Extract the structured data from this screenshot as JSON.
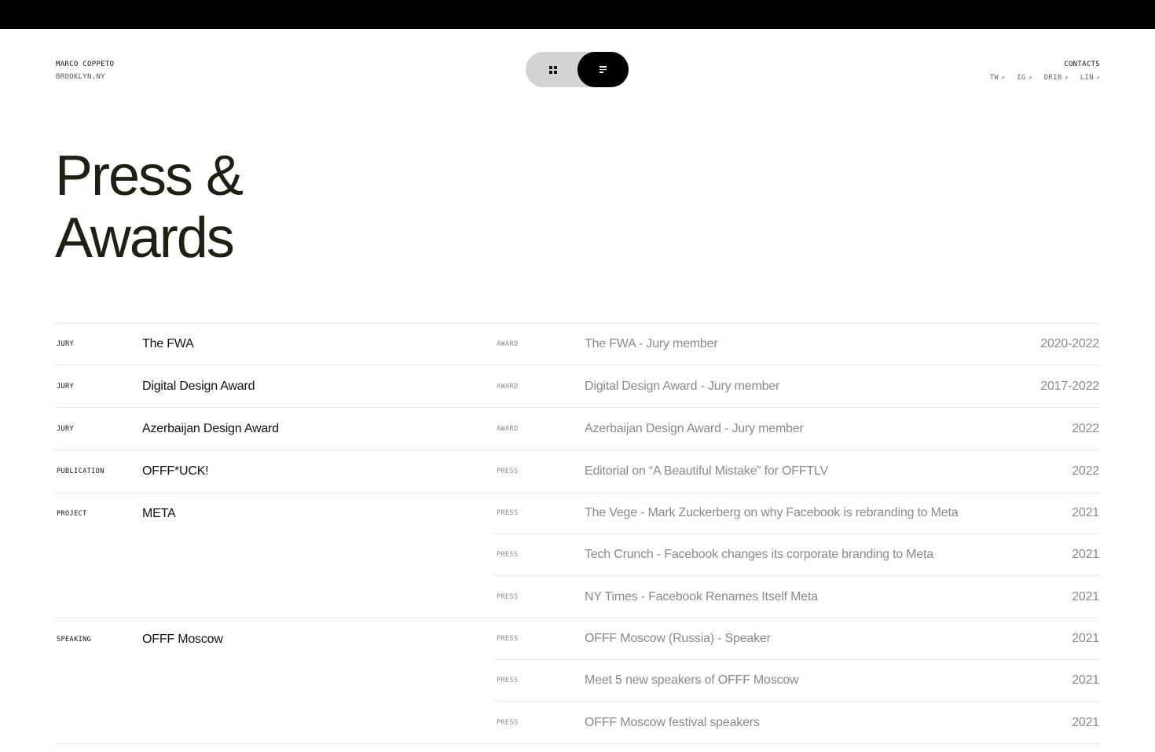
{
  "header": {
    "name": "MARCO COPPETO",
    "location": "BROOKLYN,NY",
    "view_toggle": {
      "options": [
        "grid",
        "list"
      ],
      "selected": "list"
    },
    "contacts": {
      "title": "CONTACTS",
      "links": [
        {
          "label": "TW",
          "icon": "arrow-up-right-icon"
        },
        {
          "label": "IG",
          "icon": "arrow-up-right-icon"
        },
        {
          "label": "DRIB",
          "icon": "arrow-up-right-icon"
        },
        {
          "label": "LIN",
          "icon": "arrow-up-right-icon"
        }
      ]
    }
  },
  "page": {
    "title_line1": "Press &",
    "title_line2": "Awards"
  },
  "groups": [
    {
      "category": "JURY",
      "project": "The FWA",
      "entries": [
        {
          "type": "AWARD",
          "title": "The FWA - Jury member",
          "year": "2020-2022"
        }
      ]
    },
    {
      "category": "JURY",
      "project": "Digital Design Award",
      "entries": [
        {
          "type": "AWARD",
          "title": "Digital Design Award - Jury member",
          "year": "2017-2022"
        }
      ]
    },
    {
      "category": "JURY",
      "project": "Azerbaijan Design Award",
      "entries": [
        {
          "type": "AWARD",
          "title": "Azerbaijan Design Award - Jury member",
          "year": "2022"
        }
      ]
    },
    {
      "category": "PUBLICATION",
      "project": "OFFF*UCK!",
      "entries": [
        {
          "type": "PRESS",
          "title": "Editorial on “A Beautiful Mistake” for OFFTLV",
          "year": "2022"
        }
      ]
    },
    {
      "category": "PROJECT",
      "project": "META",
      "entries": [
        {
          "type": "PRESS",
          "title": "The Vege - Mark Zuckerberg on why Facebook is rebranding to Meta",
          "year": "2021"
        },
        {
          "type": "PRESS",
          "title": "Tech Crunch - Facebook changes its corporate branding to Meta",
          "year": "2021"
        },
        {
          "type": "PRESS",
          "title": "NY Times - Facebook Renames Itself Meta",
          "year": "2021"
        }
      ]
    },
    {
      "category": "SPEAKING",
      "project": "OFFF Moscow",
      "entries": [
        {
          "type": "PRESS",
          "title": "OFFF Moscow (Russia) - Speaker",
          "year": "2021"
        },
        {
          "type": "PRESS",
          "title": "Meet 5 new speakers of OFFF Moscow",
          "year": "2021"
        },
        {
          "type": "PRESS",
          "title": "OFFF Moscow festival speakers",
          "year": "2021"
        }
      ]
    }
  ]
}
